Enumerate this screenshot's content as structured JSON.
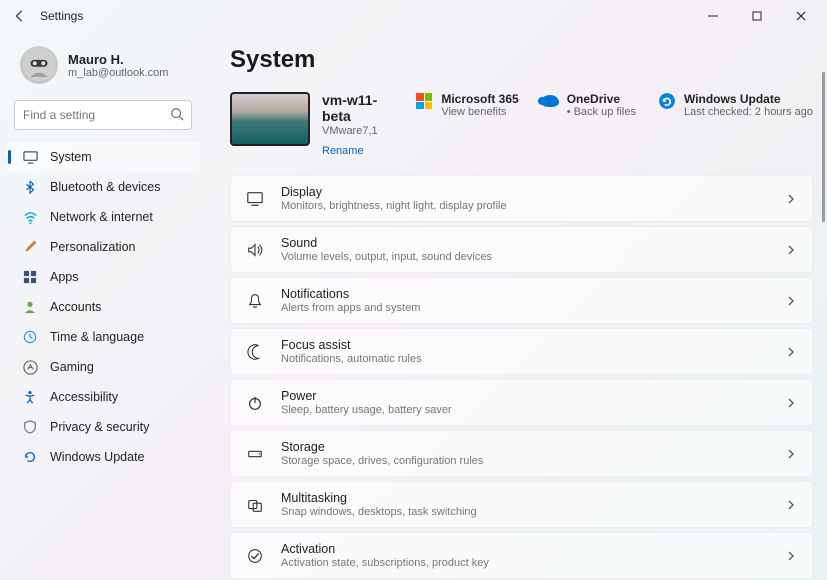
{
  "window": {
    "title": "Settings"
  },
  "user": {
    "name": "Mauro H.",
    "email": "m_lab@outlook.com"
  },
  "search": {
    "placeholder": "Find a setting"
  },
  "nav": {
    "items": [
      {
        "label": "System"
      },
      {
        "label": "Bluetooth & devices"
      },
      {
        "label": "Network & internet"
      },
      {
        "label": "Personalization"
      },
      {
        "label": "Apps"
      },
      {
        "label": "Accounts"
      },
      {
        "label": "Time & language"
      },
      {
        "label": "Gaming"
      },
      {
        "label": "Accessibility"
      },
      {
        "label": "Privacy & security"
      },
      {
        "label": "Windows Update"
      }
    ]
  },
  "page": {
    "title": "System"
  },
  "device": {
    "name": "vm-w11-beta",
    "vm": "VMware7,1",
    "rename": "Rename"
  },
  "cloud": {
    "ms365": {
      "title": "Microsoft 365",
      "sub": "View benefits"
    },
    "onedrive": {
      "title": "OneDrive",
      "sub": "• Back up files"
    },
    "update": {
      "title": "Windows Update",
      "sub": "Last checked: 2 hours ago"
    }
  },
  "cards": [
    {
      "title": "Display",
      "sub": "Monitors, brightness, night light, display profile"
    },
    {
      "title": "Sound",
      "sub": "Volume levels, output, input, sound devices"
    },
    {
      "title": "Notifications",
      "sub": "Alerts from apps and system"
    },
    {
      "title": "Focus assist",
      "sub": "Notifications, automatic rules"
    },
    {
      "title": "Power",
      "sub": "Sleep, battery usage, battery saver"
    },
    {
      "title": "Storage",
      "sub": "Storage space, drives, configuration rules"
    },
    {
      "title": "Multitasking",
      "sub": "Snap windows, desktops, task switching"
    },
    {
      "title": "Activation",
      "sub": "Activation state, subscriptions, product key"
    }
  ]
}
